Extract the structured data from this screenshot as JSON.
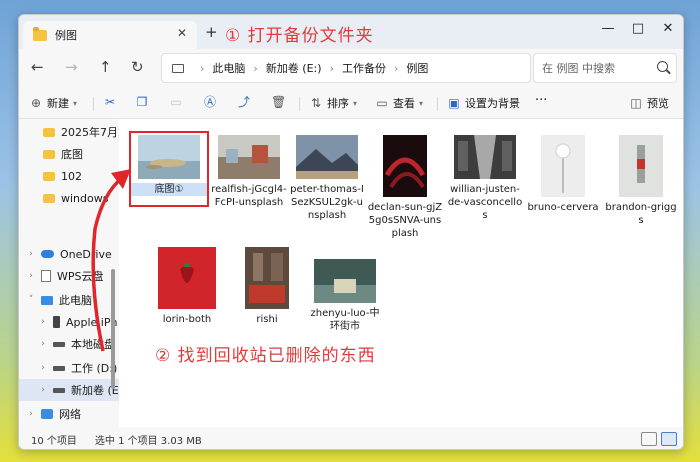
{
  "window": {
    "tab_title": "例图",
    "new_tab": "+",
    "annotation_open": "① 打开备份文件夹",
    "min": "—",
    "max": "□",
    "close": "✕"
  },
  "nav": {
    "back": "←",
    "forward": "→",
    "up": "↑",
    "refresh": "↻",
    "breadcrumb": [
      "此电脑",
      "新加卷 (E:)",
      "工作备份",
      "例图"
    ],
    "sep": "›",
    "search_placeholder": "在 例图 中搜索"
  },
  "toolbar": {
    "new": "新建",
    "sort": "排序",
    "view": "查看",
    "set_bg": "设置为背景",
    "more": "···",
    "preview": "预览"
  },
  "sidebar": {
    "items": [
      {
        "label": "2025年7月2",
        "type": "folder"
      },
      {
        "label": "底图",
        "type": "folder"
      },
      {
        "label": "102",
        "type": "folder"
      },
      {
        "label": "windows",
        "type": "folder"
      },
      {
        "label": "OneDrive",
        "type": "cloud"
      },
      {
        "label": "WPS云盘",
        "type": "doc"
      },
      {
        "label": "此电脑",
        "type": "pc"
      },
      {
        "label": "Apple iPh",
        "type": "phone"
      },
      {
        "label": "本地磁盘 (",
        "type": "drive"
      },
      {
        "label": "工作 (D:)",
        "type": "drive"
      },
      {
        "label": "新加卷 (E:)",
        "type": "drive"
      },
      {
        "label": "网络",
        "type": "net"
      }
    ]
  },
  "files": [
    {
      "name": "底图①",
      "color": "#a9c6d8"
    },
    {
      "name": "realfish-jGcgl4-FcPI-unsplash",
      "color": "#9aa7b3"
    },
    {
      "name": "peter-thomas-ISezKSUL2gk-unsplash",
      "color": "#5b6e86"
    },
    {
      "name": "declan-sun-gjZ5g0sSNVA-unsplash",
      "color": "#5a1215"
    },
    {
      "name": "willian-justen-de-vasconcellos",
      "color": "#4b4b4b"
    },
    {
      "name": "bruno-cervera",
      "color": "#e9e9e9"
    },
    {
      "name": "brandon-griggs",
      "color": "#d9dbd9"
    },
    {
      "name": "lorin-both",
      "color": "#d4242b"
    },
    {
      "name": "rishi",
      "color": "#6e5848"
    },
    {
      "name": "zhenyu-luo-中环街市",
      "color": "#4f6e66"
    }
  ],
  "annotation_find": "② 找到回收站已删除的东西",
  "status": {
    "count": "10 个项目",
    "selected": "选中 1 个项目  3.03 MB"
  }
}
